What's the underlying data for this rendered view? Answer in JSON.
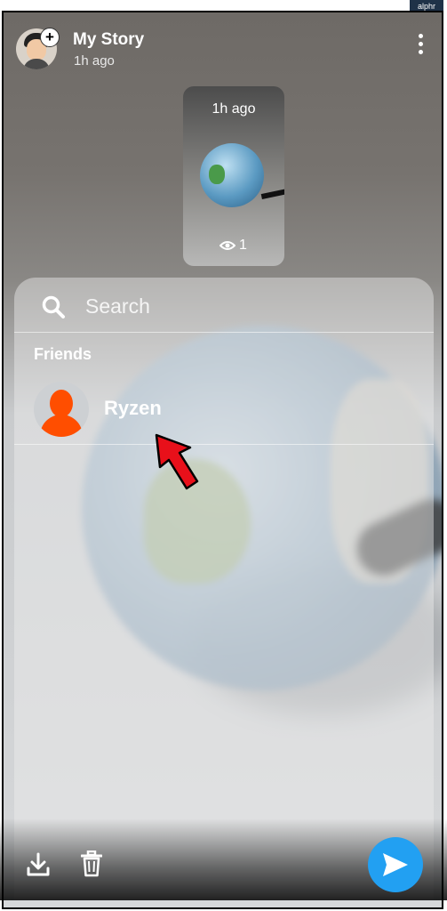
{
  "watermark": {
    "text": "alphr"
  },
  "header": {
    "story_title": "My Story",
    "story_time": "1h ago",
    "add_badge": "+",
    "more_icon": "more-vertical-icon"
  },
  "snap": {
    "time": "1h ago",
    "view_count": "1",
    "eye_icon": "eye-icon"
  },
  "sheet": {
    "search_placeholder": "Search",
    "section_label": "Friends",
    "friends": [
      {
        "name": "Ryzen"
      }
    ]
  },
  "bottom_bar": {
    "download_icon": "download-icon",
    "trash_icon": "trash-icon",
    "send_icon": "send-icon",
    "send_color": "#22a0f2"
  },
  "colors": {
    "bitmoji_orange": "#ff4e00",
    "arrow_red": "#e8101a"
  }
}
